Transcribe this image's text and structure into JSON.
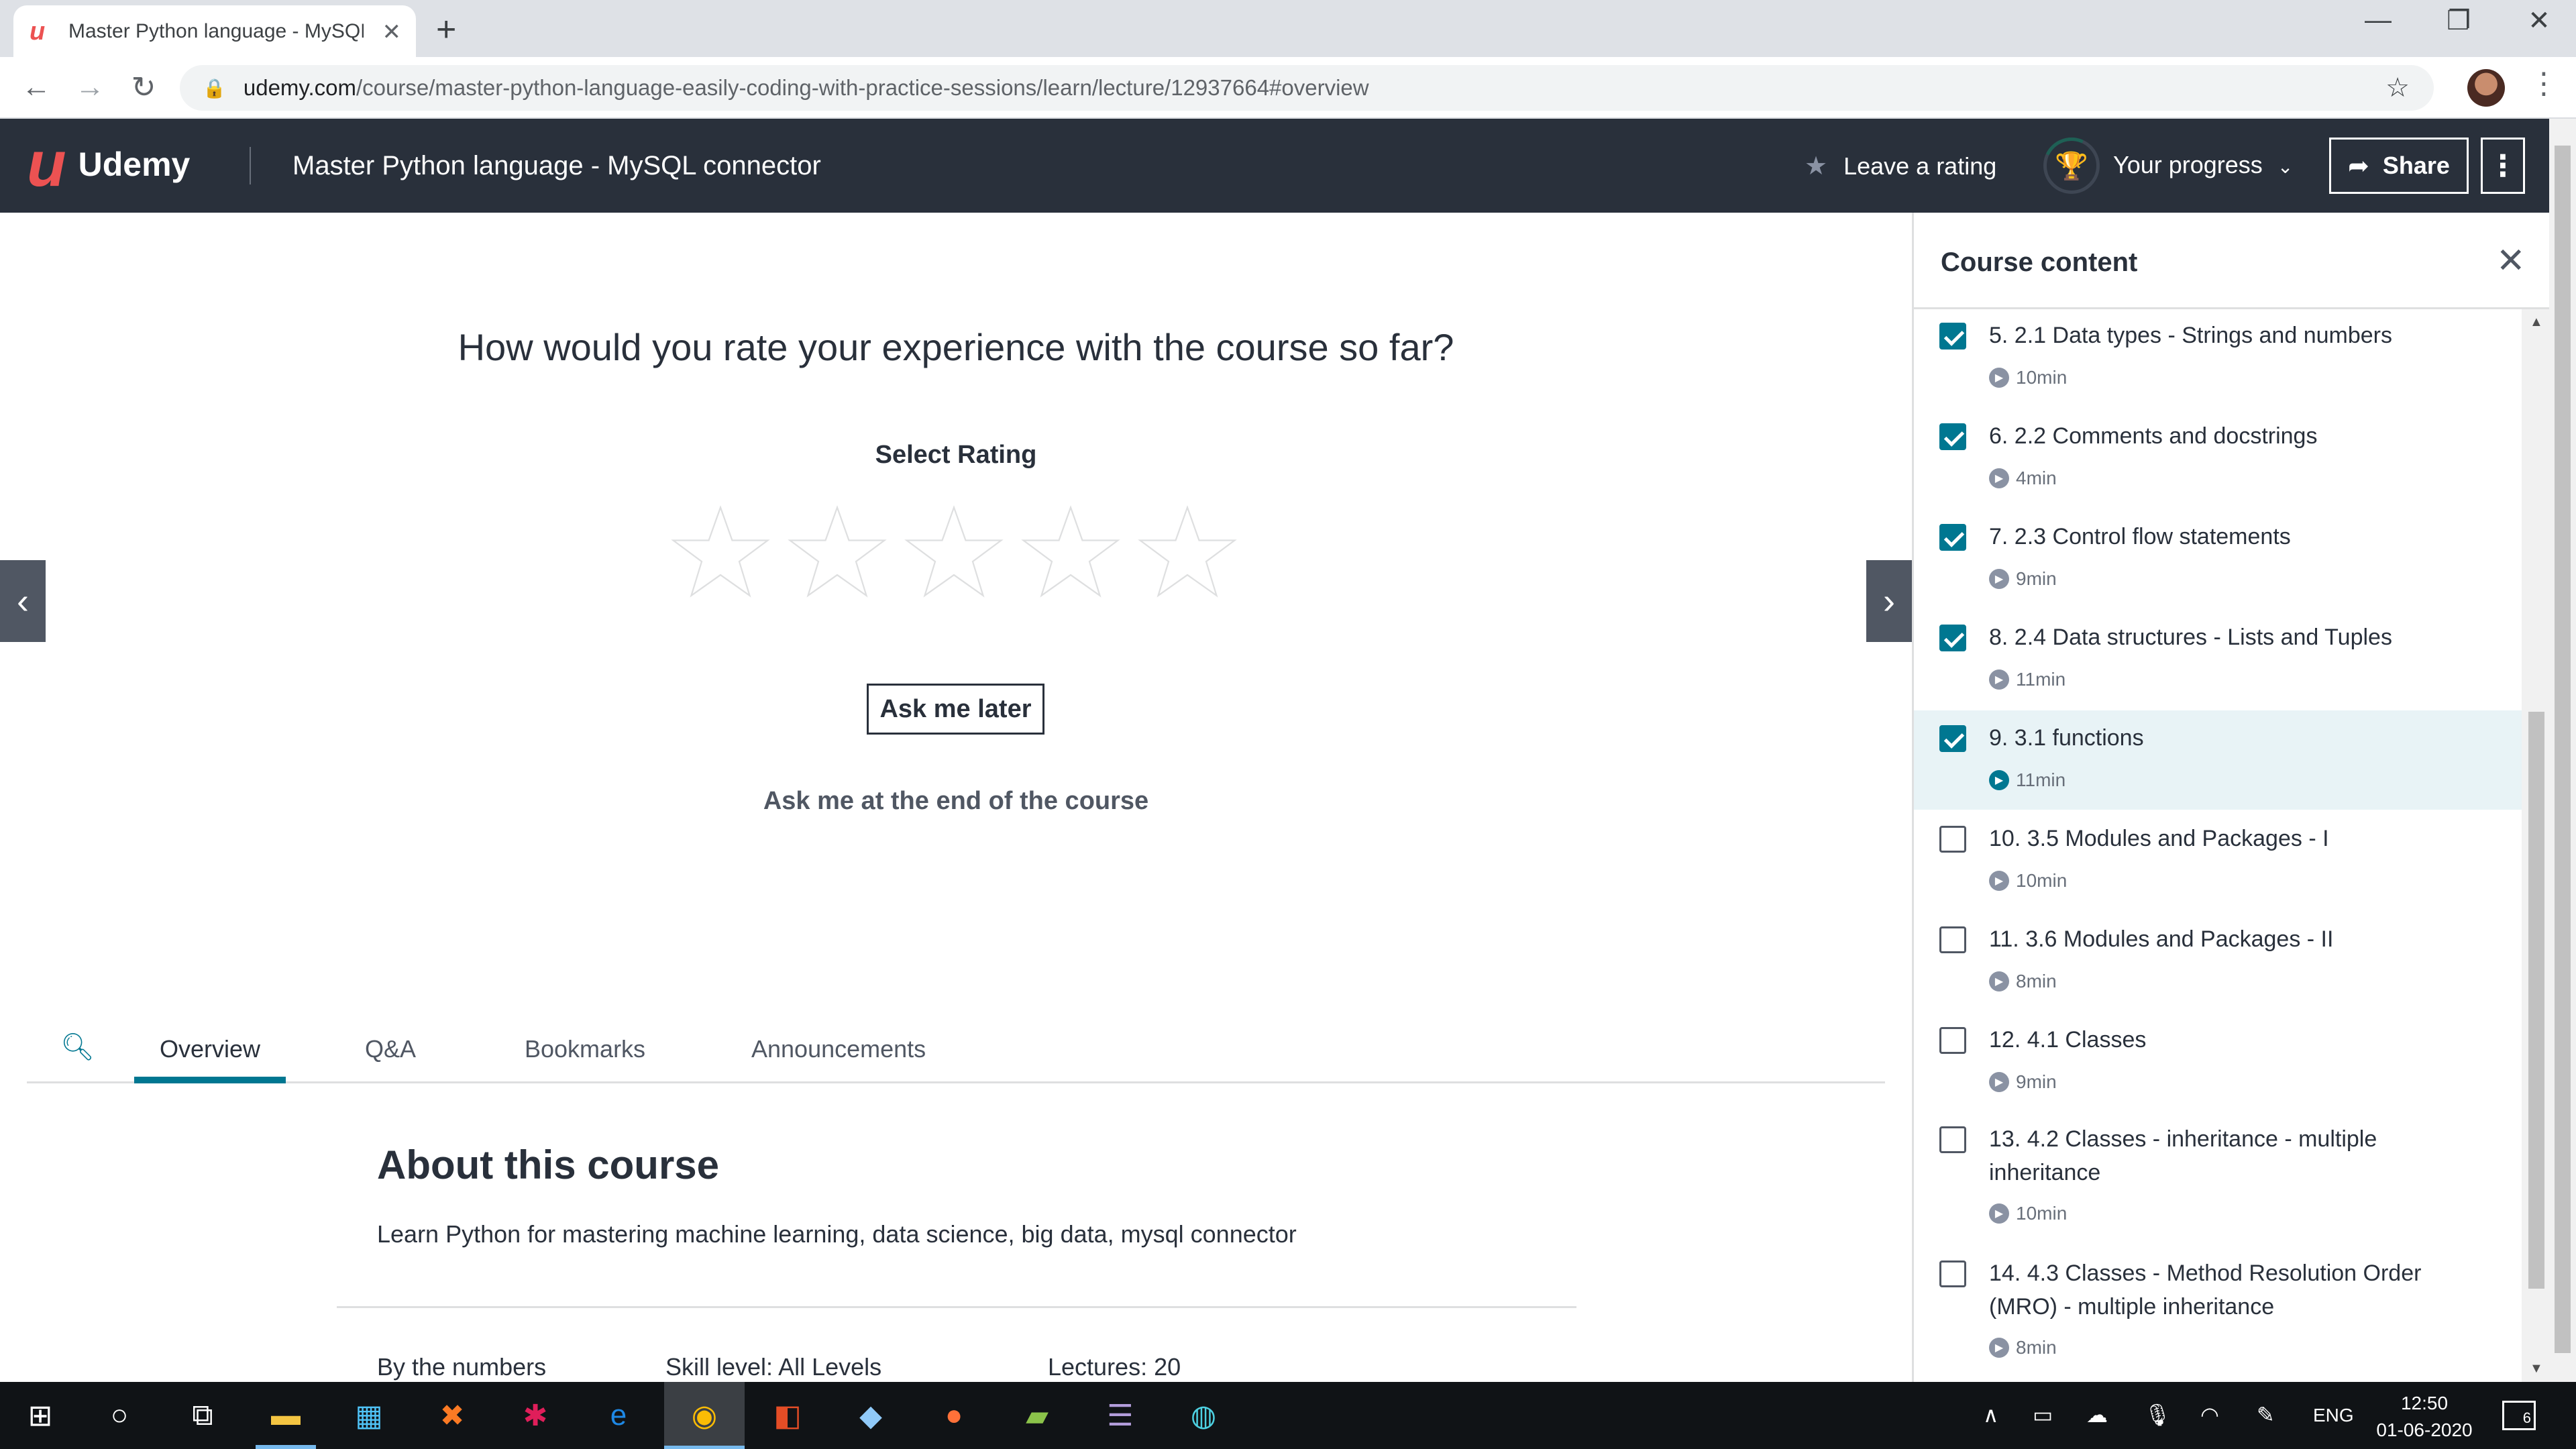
{
  "browser": {
    "tab_title": "Master Python language - MySQL connector",
    "new_tab": "+",
    "close_tab": "✕",
    "url_host": "udemy.com",
    "url_path": "/course/master-python-language-easily-coding-with-practice-sessions/learn/lecture/12937664#overview"
  },
  "header": {
    "logo_text": "Udemy",
    "course_title": "Master Python language - MySQL connector",
    "leave_rating": "Leave a rating",
    "your_progress": "Your progress",
    "share": "Share"
  },
  "rating_prompt": {
    "question": "How would you rate your experience with the course so far?",
    "select_rating": "Select Rating",
    "star_count": 5,
    "ask_later": "Ask me later",
    "ask_end": "Ask me at the end of the course"
  },
  "tabs": {
    "items": [
      "Overview",
      "Q&A",
      "Bookmarks",
      "Announcements"
    ],
    "active": "Overview"
  },
  "about": {
    "heading": "About this course",
    "description": "Learn Python for mastering machine learning, data science, big data, mysql connector",
    "by_numbers": "By the numbers",
    "skill_level": "Skill level: All Levels",
    "lectures": "Lectures: 20"
  },
  "sidebar": {
    "title": "Course content",
    "items": [
      {
        "title": "5. 2.1 Data types - Strings and numbers",
        "duration": "10min",
        "checked": true,
        "current": false
      },
      {
        "title": "6. 2.2 Comments and docstrings",
        "duration": "4min",
        "checked": true,
        "current": false
      },
      {
        "title": "7. 2.3 Control flow statements",
        "duration": "9min",
        "checked": true,
        "current": false
      },
      {
        "title": "8. 2.4 Data structures - Lists and Tuples",
        "duration": "11min",
        "checked": true,
        "current": false
      },
      {
        "title": "9. 3.1 functions",
        "duration": "11min",
        "checked": true,
        "current": true
      },
      {
        "title": "10. 3.5 Modules and Packages - I",
        "duration": "10min",
        "checked": false,
        "current": false
      },
      {
        "title": "11. 3.6 Modules and Packages - II",
        "duration": "8min",
        "checked": false,
        "current": false
      },
      {
        "title": "12. 4.1 Classes",
        "duration": "9min",
        "checked": false,
        "current": false
      },
      {
        "title": "13. 4.2 Classes - inheritance - multiple inheritance",
        "duration": "10min",
        "checked": false,
        "current": false
      },
      {
        "title": "14. 4.3 Classes - Method Resolution Order (MRO) - multiple inheritance",
        "duration": "8min",
        "checked": false,
        "current": false
      }
    ]
  },
  "taskbar": {
    "language": "ENG",
    "time": "12:50",
    "date": "01-06-2020",
    "notifications": "6"
  },
  "colors": {
    "header_bg": "#29303b",
    "brand_red": "#ec5252",
    "accent_teal": "#007791",
    "current_item_bg": "#e8f3f6"
  }
}
